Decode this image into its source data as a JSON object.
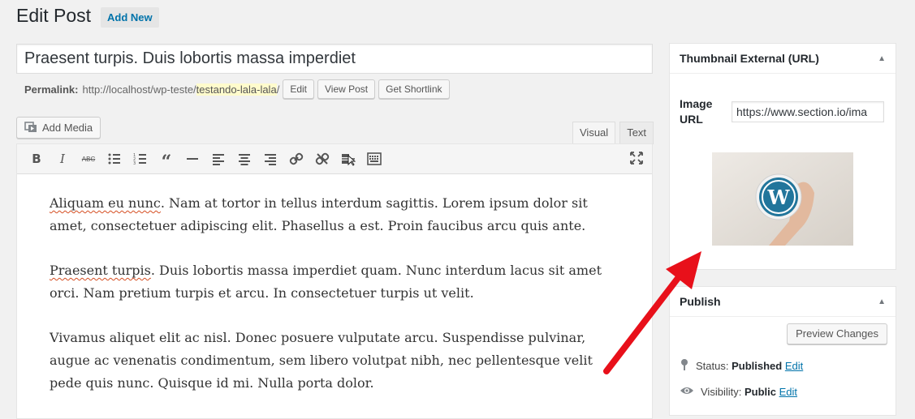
{
  "header": {
    "title": "Edit Post",
    "add_new": "Add New"
  },
  "post": {
    "title": "Praesent turpis. Duis lobortis massa imperdiet"
  },
  "permalink": {
    "label": "Permalink:",
    "base": "http://localhost/wp-teste/",
    "slug": "testando-lala-lala",
    "trail": "/",
    "edit_btn": "Edit",
    "view_btn": "View Post",
    "shortlink_btn": "Get Shortlink"
  },
  "editor": {
    "add_media": "Add Media",
    "tabs": {
      "visual": "Visual",
      "text": "Text"
    },
    "toolbar": [
      "bold-icon",
      "italic-icon",
      "strikethrough-icon",
      "bullet-list-icon",
      "numbered-list-icon",
      "blockquote-icon",
      "horizontal-line-icon",
      "align-left-icon",
      "align-center-icon",
      "align-right-icon",
      "link-icon",
      "unlink-icon",
      "read-more-icon",
      "toolbar-toggle-icon",
      "fullscreen-icon"
    ],
    "paragraphs": [
      {
        "spell": "Aliquam eu nunc",
        "rest": ". Nam at tortor in tellus interdum sagittis. Lorem ipsum dolor sit amet, consectetuer adipiscing elit. Phasellus a est. Proin faucibus arcu quis ante."
      },
      {
        "spell": "Praesent turpis",
        "rest": ". Duis lobortis massa imperdiet quam. Nunc interdum lacus sit amet orci. Nam pretium turpis et arcu. In consectetuer turpis ut velit."
      },
      {
        "spell": "",
        "rest": "Vivamus aliquet elit ac nisl. Donec posuere vulputate arcu. Suspendisse pulvinar, augue ac venenatis condimentum, sem libero volutpat nibh, nec pellentesque velit pede quis nunc. Quisque id mi. Nulla porta dolor."
      }
    ]
  },
  "thumbnail_box": {
    "title": "Thumbnail External (URL)",
    "image_url_label": "Image URL",
    "image_url_value": "https://www.section.io/ima"
  },
  "publish_box": {
    "title": "Publish",
    "preview": "Preview Changes",
    "status_label": "Status:",
    "status_value": "Published",
    "visibility_label": "Visibility:",
    "visibility_value": "Public",
    "edit": "Edit"
  },
  "colors": {
    "link": "#0073aa",
    "annotation_arrow": "#e8101a",
    "highlight": "#fffbcc"
  }
}
